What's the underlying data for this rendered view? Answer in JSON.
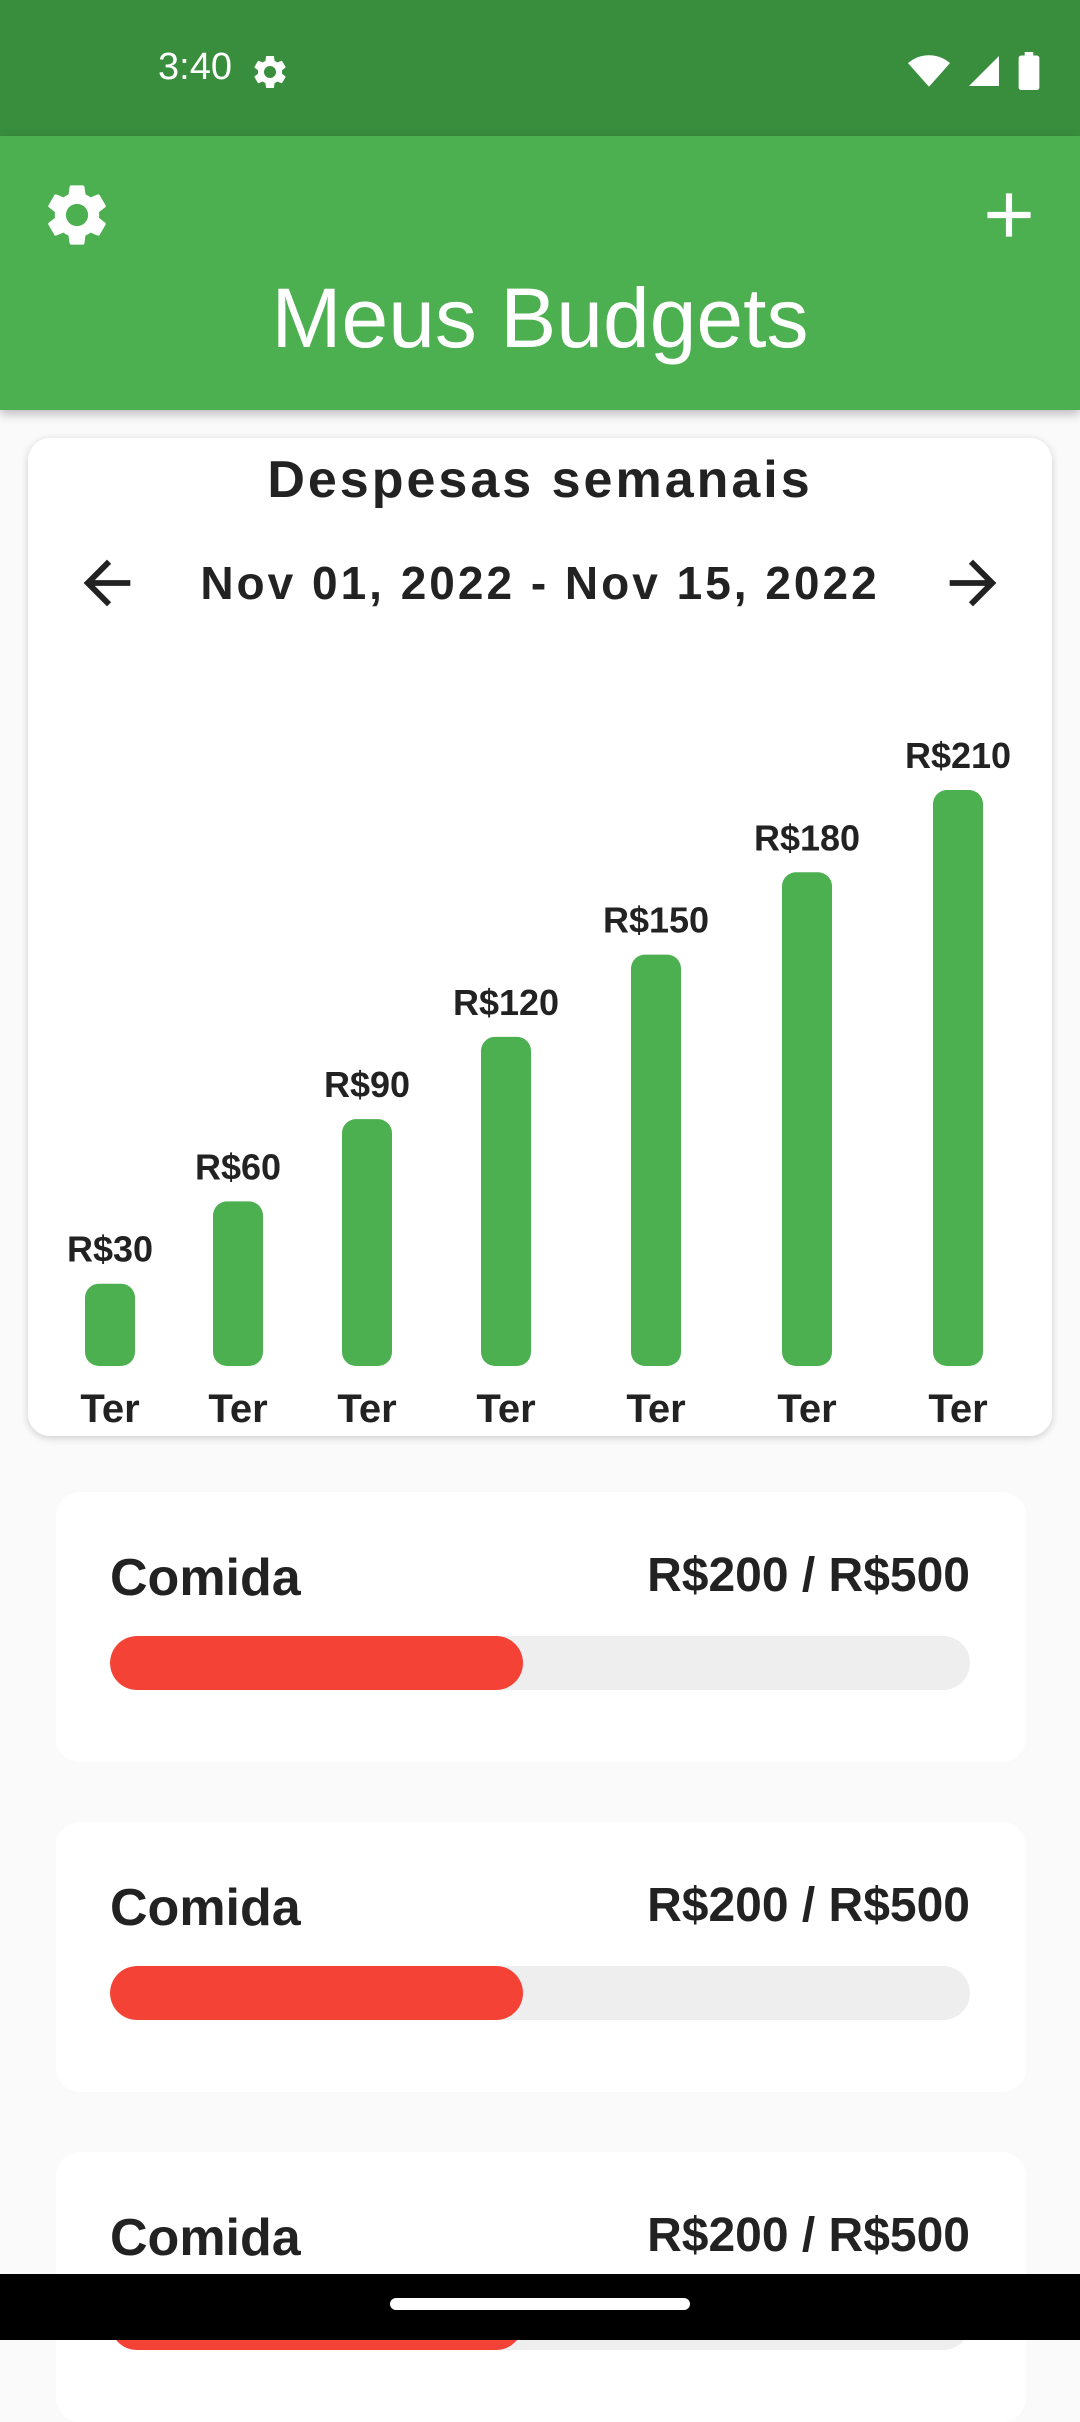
{
  "status_bar": {
    "time": "3:40",
    "icons": [
      "settings-gear-icon",
      "wifi-icon",
      "cell-signal-icon",
      "battery-icon"
    ]
  },
  "app_bar": {
    "title": "Meus Budgets",
    "icons": [
      "settings-icon",
      "add-icon"
    ]
  },
  "chart_card": {
    "title": "Despesas semanais",
    "date_range": "Nov 01, 2022 - Nov 15, 2022",
    "nav_icons": [
      "arrow-left-icon",
      "arrow-right-icon"
    ]
  },
  "chart_data": {
    "type": "bar",
    "categories": [
      "Ter",
      "Ter",
      "Ter",
      "Ter",
      "Ter",
      "Ter",
      "Ter"
    ],
    "values": [
      30,
      60,
      90,
      120,
      150,
      180,
      210
    ],
    "value_labels": [
      "R$30",
      "R$60",
      "R$90",
      "R$120",
      "R$150",
      "R$180",
      "R$210"
    ],
    "title": "Despesas semanais",
    "bar_color": "#4caf50",
    "ylim": [
      0,
      210
    ],
    "grid": false
  },
  "budgets": [
    {
      "name": "Comida",
      "amount_text": "R$200 / R$500",
      "progress": 0.48,
      "color": "#f44336"
    },
    {
      "name": "Comida",
      "amount_text": "R$200 / R$500",
      "progress": 0.48,
      "color": "#f44336"
    },
    {
      "name": "Comida",
      "amount_text": "R$200 / R$500",
      "progress": 0.48,
      "color": "#f44336"
    }
  ],
  "colors": {
    "status_bar": "#388e3c",
    "app_bar": "#4caf50",
    "accent": "#4caf50",
    "over_budget": "#f44336",
    "track": "#eeeeee"
  }
}
